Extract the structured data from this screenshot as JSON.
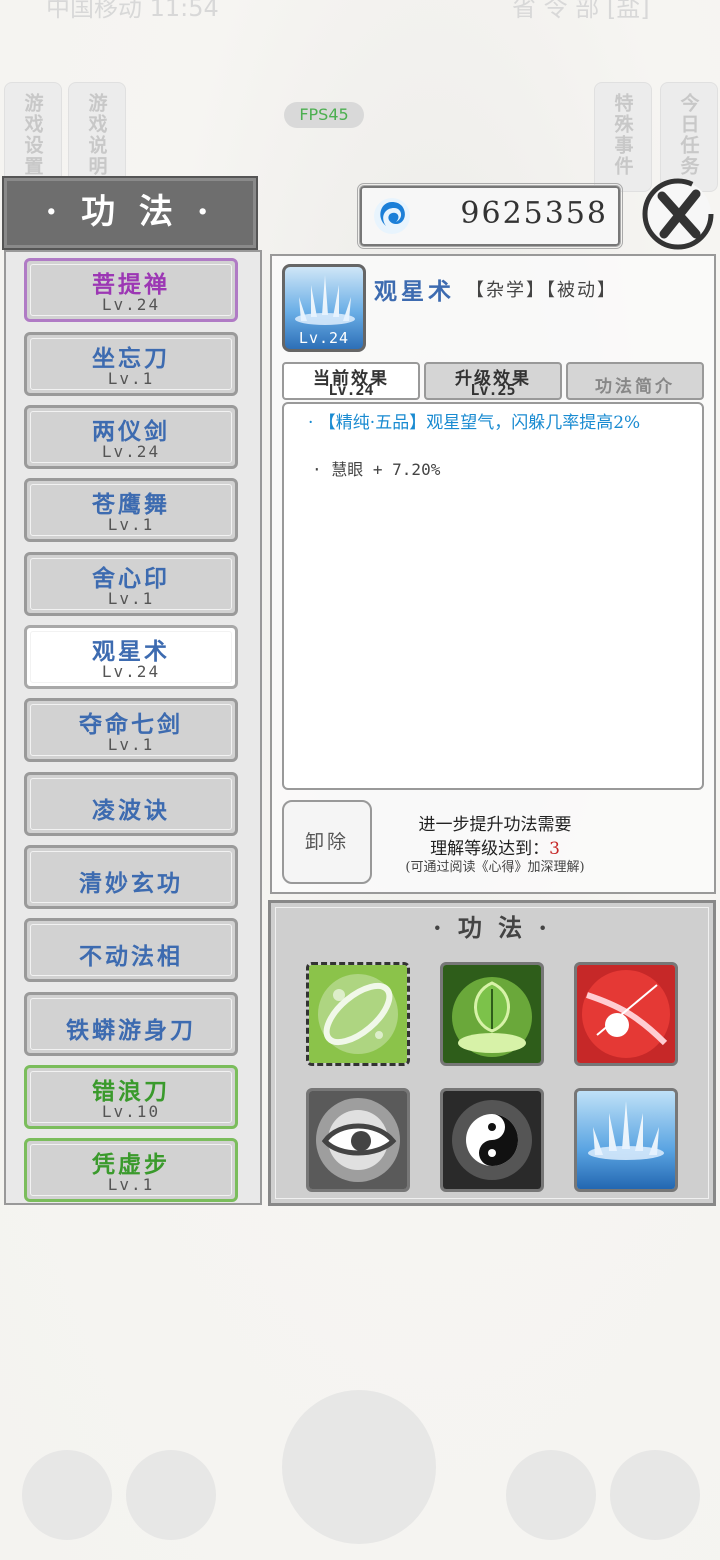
{
  "status_bar": {
    "carrier": "中国移动 11:54",
    "right": "省 令 部 [盐]"
  },
  "side_tabs": {
    "left1": "游戏设置",
    "left2": "游戏说明",
    "right1": "特殊事件",
    "right2": "今日任务"
  },
  "fps": "FPS45",
  "header": {
    "title": "· 功 法 ·",
    "currency_amount": "9625358",
    "currency_icon": "swirl-icon",
    "close_icon": "close-icon"
  },
  "skill_list": [
    {
      "name": "菩提禅",
      "level": "Lv.24",
      "color": "purple"
    },
    {
      "name": "坐忘刀",
      "level": "Lv.1",
      "color": "blue"
    },
    {
      "name": "两仪剑",
      "level": "Lv.24",
      "color": "blue"
    },
    {
      "name": "苍鹰舞",
      "level": "Lv.1",
      "color": "blue"
    },
    {
      "name": "舍心印",
      "level": "Lv.1",
      "color": "blue"
    },
    {
      "name": "观星术",
      "level": "Lv.24",
      "color": "blue",
      "selected": true
    },
    {
      "name": "夺命七剑",
      "level": "Lv.1",
      "color": "blue"
    },
    {
      "name": "凌波诀",
      "level": "",
      "color": "blue"
    },
    {
      "name": "清妙玄功",
      "level": "",
      "color": "blue"
    },
    {
      "name": "不动法相",
      "level": "",
      "color": "blue"
    },
    {
      "name": "铁蟒游身刀",
      "level": "",
      "color": "blue"
    },
    {
      "name": "错浪刀",
      "level": "Lv.10",
      "color": "green"
    },
    {
      "name": "凭虚步",
      "level": "Lv.1",
      "color": "green"
    }
  ],
  "detail": {
    "icon_level": "Lv.24",
    "name": "观星术",
    "tags": "【杂学】【被动】",
    "tabs": [
      {
        "label": "当前效果",
        "sub": "Lv.24",
        "active": true
      },
      {
        "label": "升级效果",
        "sub": "Lv.25",
        "active": false
      },
      {
        "label": "功法简介",
        "sub": "",
        "active": false
      }
    ],
    "effect_1": "· 【精纯·五品】观星望气，闪躲几率提高2%",
    "effect_2": "· 慧眼 + 7.20%",
    "remove_label": "卸除",
    "req_line1": "进一步提升功法需要",
    "req_line2_prefix": "理解等级达到：",
    "req_line2_value": "3",
    "req_line3": "(可通过阅读《心得》加深理解)"
  },
  "equipped": {
    "title": "· 功 法 ·",
    "slots": [
      "green-swirl-icon",
      "green-leaf-icon",
      "red-slash-icon",
      "gray-eye-icon",
      "yin-yang-icon",
      "blue-star-icon"
    ]
  }
}
